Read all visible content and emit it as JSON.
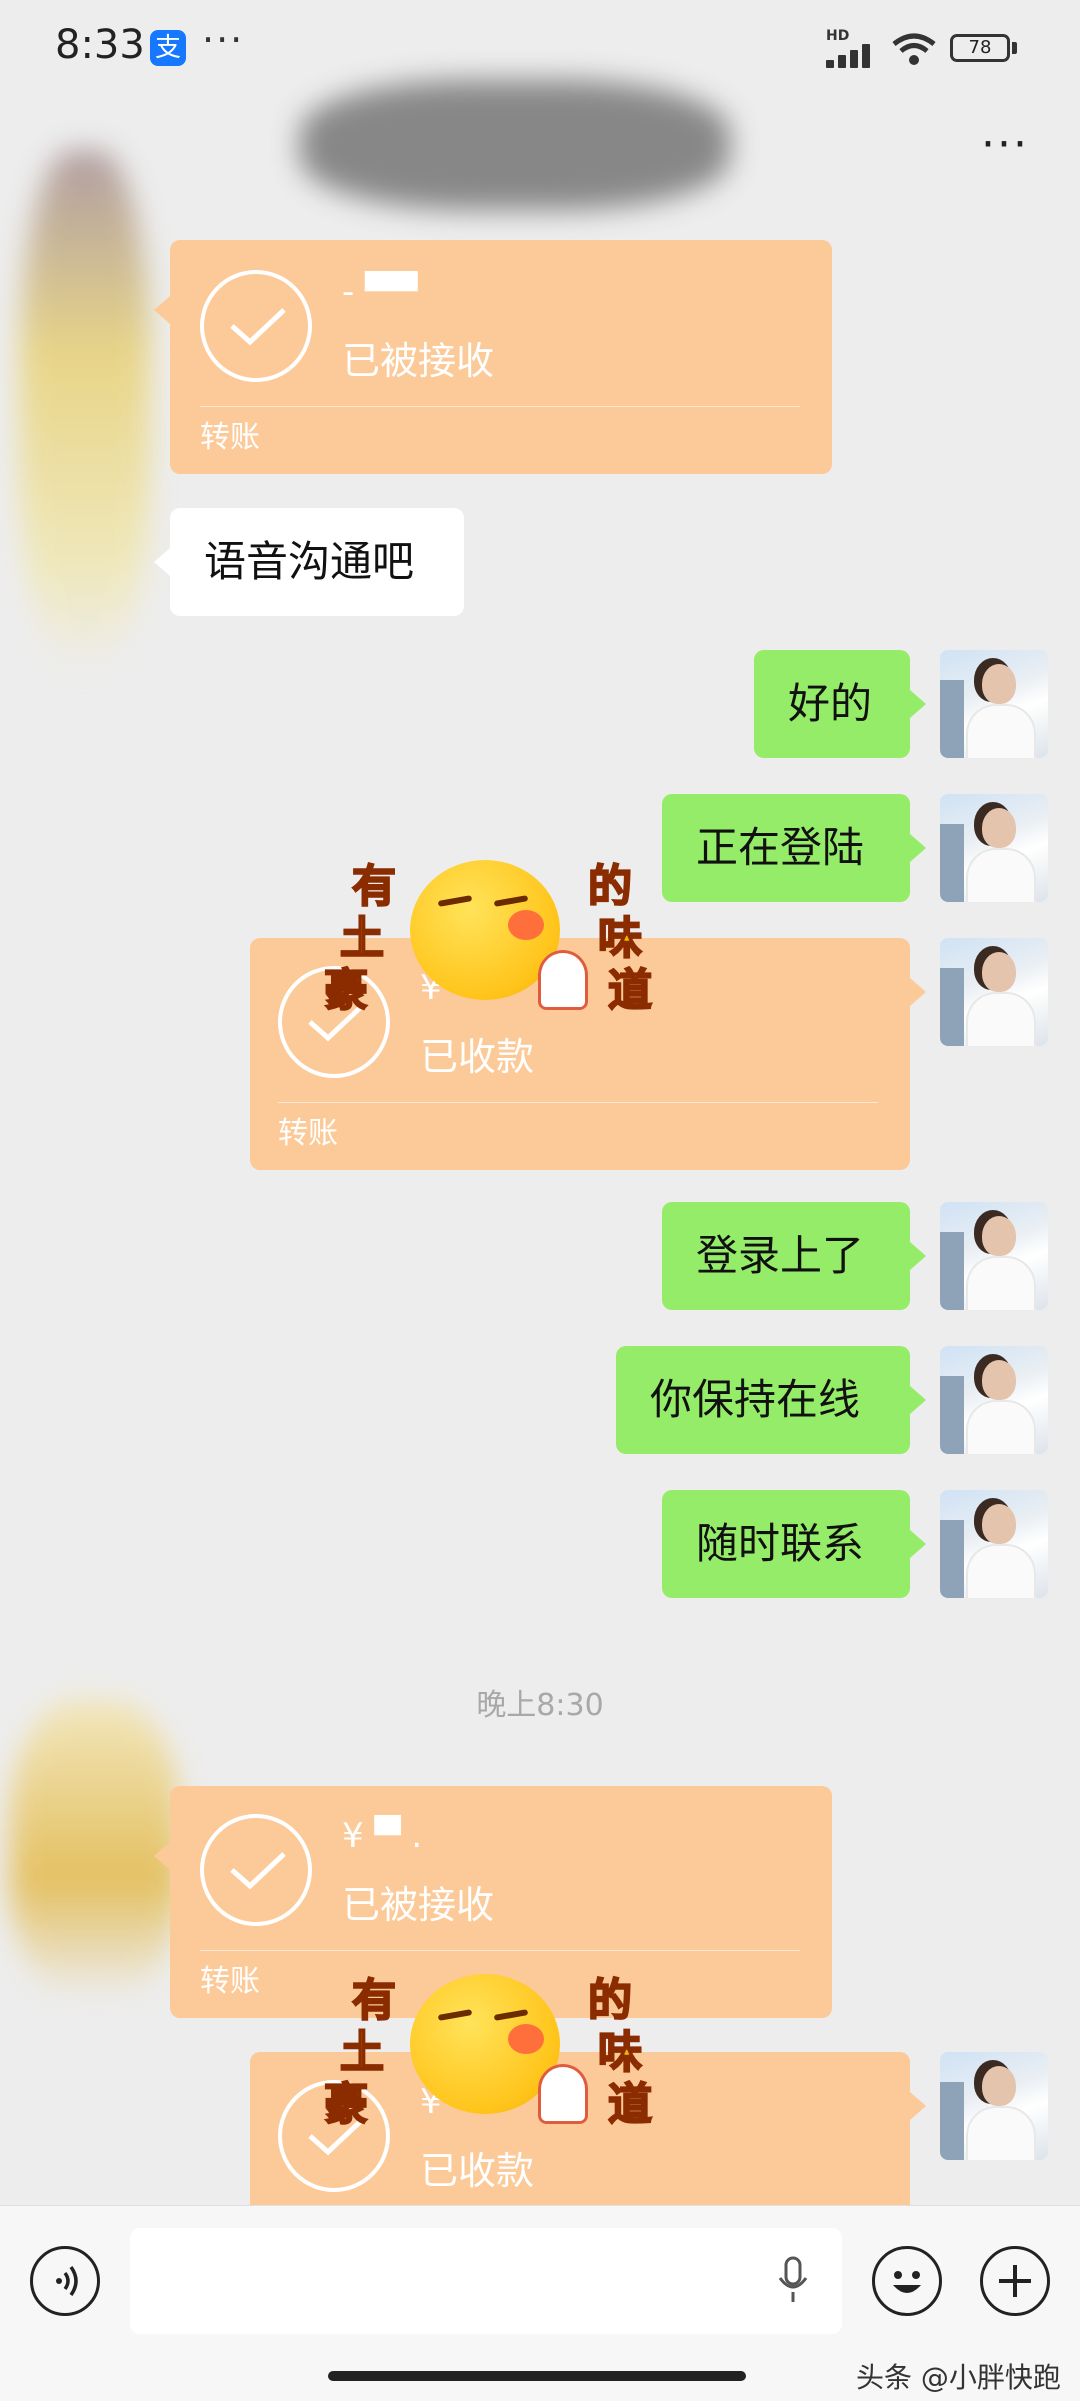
{
  "status_bar": {
    "time": "8:33",
    "app_badge": "支",
    "overflow_dots": "···",
    "network_label": "HD",
    "battery": "78"
  },
  "header": {
    "more_label": "···"
  },
  "messages": {
    "transfer_1": {
      "amount": "- ▀▀",
      "status": "已被接收",
      "kind": "转账"
    },
    "incoming_text": "语音沟通吧",
    "out_1": "好的",
    "out_2": "正在登陆",
    "transfer_2": {
      "amount": "¥",
      "status": "已收款",
      "kind": "转账"
    },
    "out_3": "登录上了",
    "out_4": "你保持在线",
    "out_5": "随时联系",
    "time_divider": "晚上8:30",
    "transfer_3": {
      "amount": "¥ ▀ .",
      "status": "已被接收",
      "kind": "转账"
    },
    "transfer_4": {
      "amount": "¥",
      "status": "已收款"
    }
  },
  "sticker": {
    "left_text": [
      "有",
      "土",
      "豪"
    ],
    "right_text": [
      "的",
      "味",
      "道"
    ]
  },
  "input_bar": {
    "watermark": "头条 @小胖快跑"
  },
  "colors": {
    "background": "#ededed",
    "outgoing_bubble": "#95ec69",
    "incoming_bubble": "#ffffff",
    "transfer_card": "#fcca99"
  }
}
